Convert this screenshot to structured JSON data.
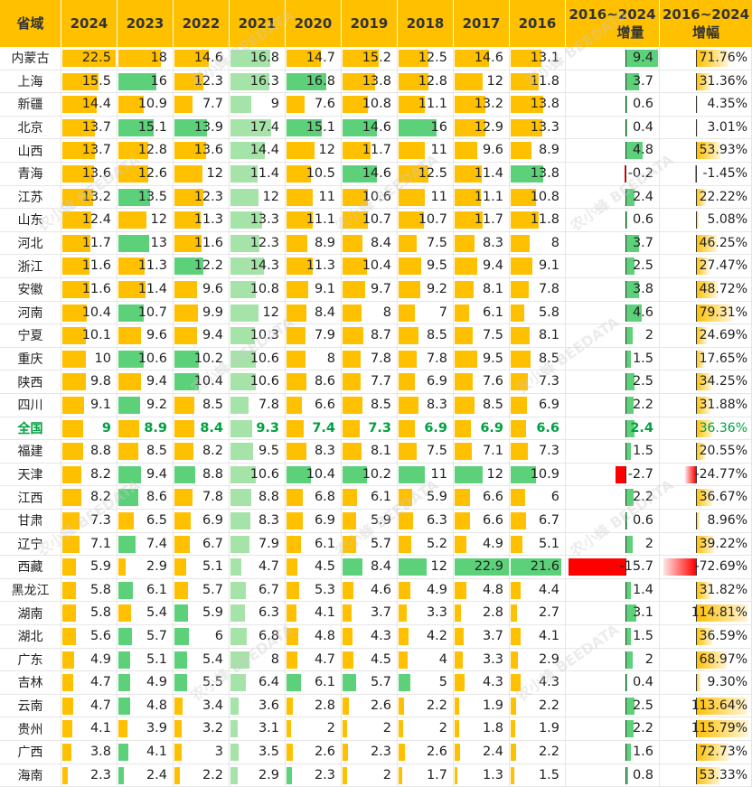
{
  "header": {
    "province": "省域",
    "years": [
      "2024",
      "2023",
      "2022",
      "2021",
      "2020",
      "2019",
      "2018",
      "2017",
      "2016"
    ],
    "increase_label_top": "2016~2024",
    "increase_label_bottom": "增量",
    "growth_label_top": "2016~2024",
    "growth_label_bottom": "增幅"
  },
  "colors": {
    "gold": "#FFC000",
    "green": "#5CD17A",
    "light_green": "#A6E3A8",
    "red": "#FF0000",
    "national_text": "#00A040"
  },
  "watermark": "农小蜂 BEEDATA",
  "chart_data": {
    "type": "table",
    "columns": [
      "2024",
      "2023",
      "2022",
      "2021",
      "2020",
      "2019",
      "2018",
      "2017",
      "2016",
      "2016~2024 增量",
      "2016~2024 增幅"
    ],
    "rows": [
      {
        "province": "内蒙古",
        "values": [
          22.5,
          18,
          14.6,
          16.8,
          14.7,
          15.2,
          12.5,
          14.6,
          13.1
        ],
        "increase": "9.4",
        "growth": "71.76%"
      },
      {
        "province": "上海",
        "values": [
          15.5,
          16,
          12.3,
          16.3,
          16.8,
          13.8,
          12.8,
          12,
          11.8
        ],
        "increase": "3.7",
        "growth": "31.36%"
      },
      {
        "province": "新疆",
        "values": [
          14.4,
          10.9,
          7.7,
          9,
          7.6,
          10.8,
          11.1,
          13.2,
          13.8
        ],
        "increase": "0.6",
        "growth": "4.35%"
      },
      {
        "province": "北京",
        "values": [
          13.7,
          15.1,
          13.9,
          17.4,
          15.1,
          14.6,
          16,
          12.9,
          13.3
        ],
        "increase": "0.4",
        "growth": "3.01%"
      },
      {
        "province": "山西",
        "values": [
          13.7,
          12.8,
          13.6,
          14.4,
          12,
          11.7,
          11,
          9.6,
          8.9
        ],
        "increase": "4.8",
        "growth": "53.93%"
      },
      {
        "province": "青海",
        "values": [
          13.6,
          12.6,
          12,
          11.4,
          10.5,
          14.6,
          12.5,
          11.4,
          13.8
        ],
        "increase": "-0.2",
        "growth": "-1.45%"
      },
      {
        "province": "江苏",
        "values": [
          13.2,
          13.5,
          12.3,
          12,
          11,
          10.6,
          11,
          11.1,
          10.8
        ],
        "increase": "2.4",
        "growth": "22.22%"
      },
      {
        "province": "山东",
        "values": [
          12.4,
          12,
          11.3,
          13.3,
          11.1,
          10.7,
          10.7,
          11.7,
          11.8
        ],
        "increase": "0.6",
        "growth": "5.08%"
      },
      {
        "province": "河北",
        "values": [
          11.7,
          13,
          11.6,
          12.3,
          8.9,
          8.4,
          7.5,
          8.3,
          8
        ],
        "increase": "3.7",
        "growth": "46.25%"
      },
      {
        "province": "浙江",
        "values": [
          11.6,
          11.3,
          12.2,
          14.3,
          11.3,
          10.4,
          9.5,
          9.4,
          9.1
        ],
        "increase": "2.5",
        "growth": "27.47%"
      },
      {
        "province": "安徽",
        "values": [
          11.6,
          11.4,
          9.6,
          10.8,
          9.1,
          9.7,
          9.2,
          8.1,
          7.8
        ],
        "increase": "3.8",
        "growth": "48.72%"
      },
      {
        "province": "河南",
        "values": [
          10.4,
          10.7,
          9.9,
          12,
          8.4,
          8,
          7,
          6.1,
          5.8
        ],
        "increase": "4.6",
        "growth": "79.31%"
      },
      {
        "province": "宁夏",
        "values": [
          10.1,
          9.6,
          9.4,
          10.3,
          7.9,
          8.7,
          8.5,
          7.5,
          8.1
        ],
        "increase": "2",
        "growth": "24.69%"
      },
      {
        "province": "重庆",
        "values": [
          10,
          10.6,
          10.2,
          10.6,
          8,
          7.8,
          7.8,
          9.5,
          8.5
        ],
        "increase": "1.5",
        "growth": "17.65%"
      },
      {
        "province": "陕西",
        "values": [
          9.8,
          9.4,
          10.4,
          10.6,
          8.6,
          7.7,
          6.9,
          7.6,
          7.3
        ],
        "increase": "2.5",
        "growth": "34.25%"
      },
      {
        "province": "四川",
        "values": [
          9.1,
          9.2,
          8.5,
          7.8,
          6.6,
          8.5,
          8.3,
          8.5,
          6.9
        ],
        "increase": "2.2",
        "growth": "31.88%"
      },
      {
        "province": "全国",
        "values": [
          9,
          8.9,
          8.4,
          9.3,
          7.4,
          7.3,
          6.9,
          6.9,
          6.6
        ],
        "increase": "2.4",
        "growth": "36.36%",
        "national": true
      },
      {
        "province": "福建",
        "values": [
          8.8,
          8.5,
          8.2,
          9.5,
          8.3,
          8.1,
          7.5,
          7.1,
          7.3
        ],
        "increase": "1.5",
        "growth": "20.55%"
      },
      {
        "province": "天津",
        "values": [
          8.2,
          9.4,
          8.8,
          10.6,
          10.4,
          10.2,
          11,
          12,
          10.9
        ],
        "increase": "-2.7",
        "growth": "-24.77%"
      },
      {
        "province": "江西",
        "values": [
          8.2,
          8.6,
          7.8,
          8.8,
          6.8,
          6.1,
          5.9,
          6.6,
          6
        ],
        "increase": "2.2",
        "growth": "36.67%"
      },
      {
        "province": "甘肃",
        "values": [
          7.3,
          6.5,
          6.9,
          8.3,
          6.9,
          5.9,
          6.3,
          6.6,
          6.7
        ],
        "increase": "0.6",
        "growth": "8.96%"
      },
      {
        "province": "辽宁",
        "values": [
          7.1,
          7.4,
          6.7,
          7.9,
          6.1,
          5.7,
          5.2,
          4.9,
          5.1
        ],
        "increase": "2",
        "growth": "39.22%"
      },
      {
        "province": "西藏",
        "values": [
          5.9,
          2.9,
          5.1,
          4.7,
          4.5,
          8.4,
          12,
          22.9,
          21.6
        ],
        "increase": "-15.7",
        "growth": "-72.69%"
      },
      {
        "province": "黑龙江",
        "values": [
          5.8,
          6.1,
          5.7,
          6.7,
          5.3,
          4.6,
          4.9,
          4.8,
          4.4
        ],
        "increase": "1.4",
        "growth": "31.82%"
      },
      {
        "province": "湖南",
        "values": [
          5.8,
          5.4,
          5.9,
          6.3,
          4.1,
          3.7,
          3.3,
          2.8,
          2.7
        ],
        "increase": "3.1",
        "growth": "114.81%"
      },
      {
        "province": "湖北",
        "values": [
          5.6,
          5.7,
          6,
          6.8,
          4.8,
          4.3,
          4.2,
          3.7,
          4.1
        ],
        "increase": "1.5",
        "growth": "36.59%"
      },
      {
        "province": "广东",
        "values": [
          4.9,
          5.1,
          5.4,
          8,
          4.7,
          4.5,
          4,
          3.3,
          2.9
        ],
        "increase": "2",
        "growth": "68.97%"
      },
      {
        "province": "吉林",
        "values": [
          4.7,
          4.9,
          5.5,
          6.4,
          6.1,
          5.7,
          5,
          4.3,
          4.3
        ],
        "increase": "0.4",
        "growth": "9.30%"
      },
      {
        "province": "云南",
        "values": [
          4.7,
          4.8,
          3.4,
          3.6,
          2.8,
          2.6,
          2.2,
          1.9,
          2.2
        ],
        "increase": "2.5",
        "growth": "113.64%"
      },
      {
        "province": "贵州",
        "values": [
          4.1,
          3.9,
          3.2,
          3.1,
          2,
          2,
          2,
          1.8,
          1.9
        ],
        "increase": "2.2",
        "growth": "115.79%"
      },
      {
        "province": "广西",
        "values": [
          3.8,
          4.1,
          3,
          3.5,
          2.6,
          2.3,
          2.6,
          2.4,
          2.2
        ],
        "increase": "1.6",
        "growth": "72.73%"
      },
      {
        "province": "海南",
        "values": [
          2.3,
          2.4,
          2.2,
          2.9,
          2.3,
          2,
          1.7,
          1.3,
          1.5
        ],
        "increase": "0.8",
        "growth": "53.33%"
      }
    ]
  }
}
